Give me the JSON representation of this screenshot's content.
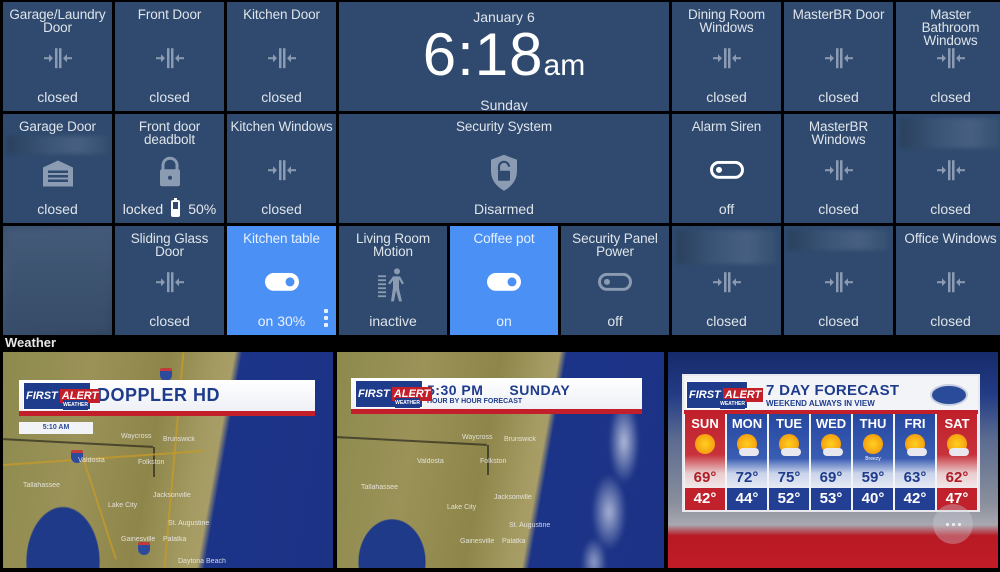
{
  "clock": {
    "date": "January 6",
    "time": "6:18",
    "ampm": "am",
    "day": "Sunday"
  },
  "tiles": [
    {
      "title": "Garage/Laundry Door",
      "state": "closed",
      "icon": "contact-sensor-closed-icon"
    },
    {
      "title": "Front Door",
      "state": "closed",
      "icon": "contact-sensor-closed-icon"
    },
    {
      "title": "Kitchen Door",
      "state": "closed",
      "icon": "contact-sensor-closed-icon"
    },
    {
      "title": "Dining Room Windows",
      "state": "closed",
      "icon": "contact-sensor-closed-icon"
    },
    {
      "title": "MasterBR Door",
      "state": "closed",
      "icon": "contact-sensor-closed-icon"
    },
    {
      "title": "Master Bathroom Windows",
      "state": "closed",
      "icon": "contact-sensor-closed-icon"
    },
    {
      "title": "Garage Door",
      "state": "closed",
      "icon": "garage-door-icon"
    },
    {
      "title": "Front door deadbolt",
      "state": "locked",
      "battery": "50%",
      "battery_level": 0.5,
      "icon": "lock-icon"
    },
    {
      "title": "Kitchen Windows",
      "state": "closed",
      "icon": "contact-sensor-closed-icon"
    },
    {
      "title": "Security System",
      "state": "Disarmed",
      "icon": "shield-unlocked-icon"
    },
    {
      "title": "Alarm Siren",
      "state": "off",
      "icon": "switch-off-icon"
    },
    {
      "title": "MasterBR Windows",
      "state": "closed",
      "icon": "contact-sensor-closed-icon"
    },
    {
      "title": "",
      "state": "closed",
      "icon": "contact-sensor-closed-icon"
    },
    {
      "title": "",
      "state": "",
      "icon": ""
    },
    {
      "title": "Sliding Glass Door",
      "state": "closed",
      "icon": "contact-sensor-closed-icon"
    },
    {
      "title": "Kitchen table",
      "state": "on 30%",
      "icon": "switch-on-icon",
      "active": true
    },
    {
      "title": "Living Room Motion",
      "state": "inactive",
      "icon": "motion-sensor-icon"
    },
    {
      "title": "Coffee pot",
      "state": "on",
      "icon": "switch-on-icon",
      "active": true
    },
    {
      "title": "Security Panel Power",
      "state": "off",
      "icon": "switch-off-icon"
    },
    {
      "title": "",
      "state": "closed",
      "icon": "contact-sensor-closed-icon"
    },
    {
      "title": "",
      "state": "closed",
      "icon": "contact-sensor-closed-icon"
    },
    {
      "title": "Office Windows",
      "state": "closed",
      "icon": "contact-sensor-closed-icon"
    }
  ],
  "weather": {
    "label": "Weather",
    "panels": [
      {
        "logo_main": "FIRST",
        "logo_accent": "ALERT",
        "logo_sub": "WEATHER",
        "title": "DOPPLER HD",
        "timestamp": "5:10 AM",
        "cities": [
          "Waycross",
          "Brunswick",
          "Valdosta",
          "Folkston",
          "Tallahassee",
          "Jacksonville",
          "Lake City",
          "St. Augustine",
          "Gainesville",
          "Palatka",
          "Daytona Beach"
        ]
      },
      {
        "logo_main": "FIRST",
        "logo_accent": "ALERT",
        "logo_sub": "WEATHER",
        "title": "5:30 PM",
        "title2": "SUNDAY",
        "subtitle": "HOUR BY HOUR FORECAST",
        "cities": [
          "Waycross",
          "Brunswick",
          "Valdosta",
          "Folkston",
          "Tallahassee",
          "Jacksonville",
          "Lake City",
          "St. Augustine",
          "Gainesville",
          "Palatka"
        ]
      },
      {
        "logo_main": "FIRST",
        "logo_accent": "ALERT",
        "logo_sub": "WEATHER",
        "title": "7 DAY FORECAST",
        "subtitle": "WEEKEND ALWAYS IN VIEW",
        "days": [
          {
            "name": "SUN",
            "hi": "69°",
            "lo": "42°",
            "icon": "sunny-icon",
            "weekend": true,
            "note": ""
          },
          {
            "name": "MON",
            "hi": "72°",
            "lo": "44°",
            "icon": "mostly-sunny-icon",
            "weekend": false,
            "note": ""
          },
          {
            "name": "TUE",
            "hi": "75°",
            "lo": "52°",
            "icon": "partly-cloudy-icon",
            "weekend": false,
            "note": ""
          },
          {
            "name": "WED",
            "hi": "69°",
            "lo": "53°",
            "icon": "mostly-sunny-icon",
            "weekend": false,
            "note": ""
          },
          {
            "name": "THU",
            "hi": "59°",
            "lo": "40°",
            "icon": "sunny-icon",
            "weekend": false,
            "note": "Breezy"
          },
          {
            "name": "FRI",
            "hi": "63°",
            "lo": "42°",
            "icon": "mostly-sunny-icon",
            "weekend": false,
            "note": ""
          },
          {
            "name": "SAT",
            "hi": "62°",
            "lo": "47°",
            "icon": "partly-cloudy-icon",
            "weekend": true,
            "note": ""
          }
        ]
      }
    ]
  },
  "colors": {
    "tile": "#2f4a6e",
    "tile_active": "#4a90f5",
    "background": "#000000"
  }
}
